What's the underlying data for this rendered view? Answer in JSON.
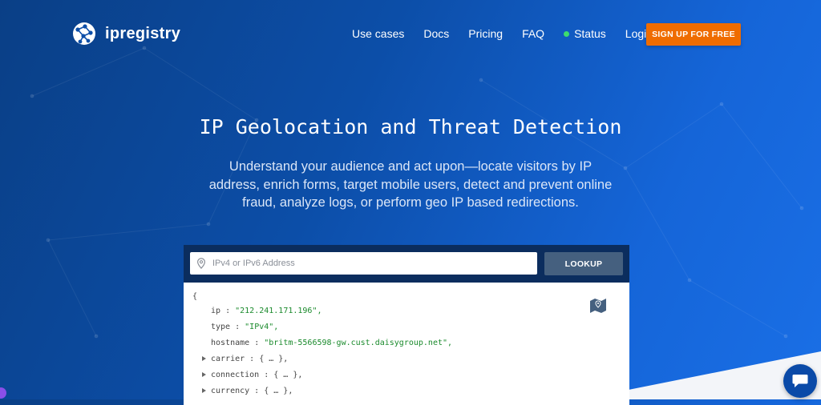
{
  "brand": {
    "name": "ipregistry"
  },
  "nav": {
    "items": [
      "Use cases",
      "Docs",
      "Pricing",
      "FAQ"
    ],
    "status_label": "Status",
    "login_label": "Login",
    "signup_label": "SIGN UP FOR FREE"
  },
  "hero": {
    "title": "IP Geolocation and Threat Detection",
    "subtitle": "Understand your audience and act upon—locate visitors by IP address, enrich forms, target mobile users, detect and prevent online fraud, analyze logs, or perform geo IP based redirections."
  },
  "lookup": {
    "placeholder": "IPv4 or IPv6 Address",
    "button_label": "LOOKUP"
  },
  "json": {
    "open_brace": "{",
    "ip_key": "ip",
    "ip_value": "\"212.241.171.196\",",
    "type_key": "type",
    "type_value": "\"IPv4\",",
    "hostname_key": "hostname",
    "hostname_value": "\"britm-5566598-gw.cust.daisygroup.net\",",
    "carrier": "carrier : { … },",
    "connection": "connection : { … },",
    "currency": "currency : { … },",
    "sep": " : "
  },
  "colors": {
    "accent": "#ef6c00",
    "status": "#3ddc6d",
    "card_header": "#0b2d5e"
  },
  "icons": [
    "logo-globe-icon",
    "status-dot-icon",
    "location-pin-icon",
    "map-icon",
    "chat-icon"
  ]
}
